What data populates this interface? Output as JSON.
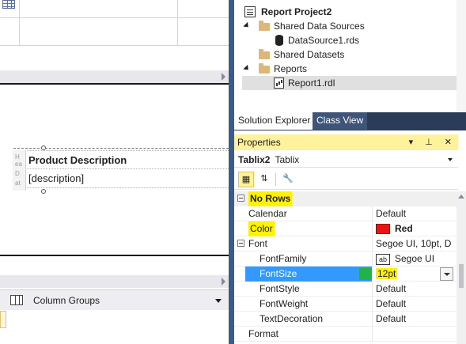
{
  "solution_explorer": {
    "items": [
      {
        "label": "Report Project2",
        "icon": "report-project-icon"
      },
      {
        "label": "Shared Data Sources",
        "icon": "folder-icon"
      },
      {
        "label": "DataSource1.rds",
        "icon": "datasource-icon"
      },
      {
        "label": "Shared Datasets",
        "icon": "folder-icon"
      },
      {
        "label": "Reports",
        "icon": "folder-icon"
      },
      {
        "label": "Report1.rdl",
        "icon": "report-file-icon"
      }
    ],
    "tabs": [
      {
        "label": "Solution Explorer",
        "active": true
      },
      {
        "label": "Class View",
        "active": false
      }
    ]
  },
  "properties": {
    "title": "Properties",
    "title_icons": "▾ ⊥ ✕",
    "object_name": "Tablix2",
    "object_type": "Tablix",
    "rows": [
      {
        "name": "No Rows",
        "value": ""
      },
      {
        "name": "Calendar",
        "value": "Default"
      },
      {
        "name": "Color",
        "value": "Red"
      },
      {
        "name": "Font",
        "value": "Segoe UI, 10pt, D"
      },
      {
        "name": "FontFamily",
        "value": "Segoe UI"
      },
      {
        "name": "FontSize",
        "value": "12pt"
      },
      {
        "name": "FontStyle",
        "value": "Default"
      },
      {
        "name": "FontWeight",
        "value": "Default"
      },
      {
        "name": "TextDecoration",
        "value": "Default"
      },
      {
        "name": "Format",
        "value": ""
      }
    ],
    "font_abbrev": "ab"
  },
  "report": {
    "header_text": "Product Description",
    "detail_text": "[description]",
    "row_handle_text": "He\nea\nD\nat"
  },
  "groups": {
    "label": "Column Groups"
  },
  "colors": {
    "accent": "#3c5a8a",
    "highlight": "#fff200",
    "selection": "#3399ff",
    "color_swatch": "#ee1111"
  }
}
